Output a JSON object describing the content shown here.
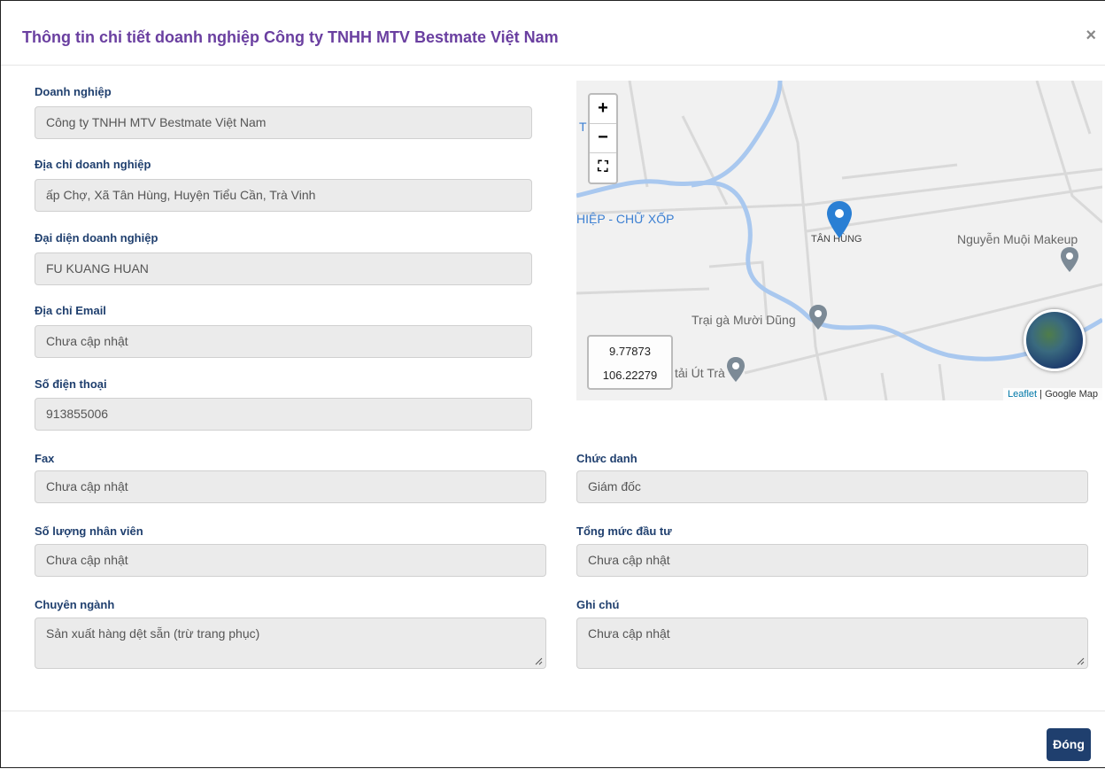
{
  "modal": {
    "title": "Thông tin chi tiết doanh nghiệp Công ty TNHH MTV Bestmate Việt Nam",
    "close_icon": "×",
    "close_button_label": "Đóng"
  },
  "fields": {
    "business": {
      "label": "Doanh nghiệp",
      "value": "Công ty TNHH MTV Bestmate Việt Nam"
    },
    "address": {
      "label": "Địa chỉ doanh nghiệp",
      "value": "ấp Chợ, Xã Tân Hùng, Huyện Tiểu Cần, Trà Vinh"
    },
    "representative": {
      "label": "Đại diện doanh nghiệp",
      "value": "FU KUANG HUAN"
    },
    "email": {
      "label": "Địa chỉ Email",
      "value": "Chưa cập nhật"
    },
    "phone": {
      "label": "Số điện thoại",
      "value": "913855006"
    },
    "fax": {
      "label": "Fax",
      "value": "Chưa cập nhật"
    },
    "position": {
      "label": "Chức danh",
      "value": "Giám đốc"
    },
    "employees": {
      "label": "Số lượng nhân viên",
      "value": "Chưa cập nhật"
    },
    "investment": {
      "label": "Tổng mức đầu tư",
      "value": "Chưa cập nhật"
    },
    "industry": {
      "label": "Chuyên ngành",
      "value": "Sản xuất hàng dệt sẵn (trừ trang phục)"
    },
    "note": {
      "label": "Ghi chú",
      "value": "Chưa cập nhật"
    }
  },
  "map": {
    "zoom_in": "+",
    "zoom_out": "−",
    "fullscreen_icon": "⛶",
    "labels": {
      "edge_t": "T",
      "place_hiep": "HIỆP - CHỮ XỐP",
      "place_tan_hung": "TÂN HÙNG",
      "poi_makeup": "Nguyễn Muội Makeup",
      "poi_farm": "Trại gà Mười Dũng",
      "poi_ut_tra": "tải Út Trà"
    },
    "coords": {
      "lat": "9.77873",
      "lng": "106.22279"
    },
    "attribution_link": "Leaflet",
    "attribution_text": "| Google Map",
    "colors": {
      "marker": "#2a7fd4",
      "poi": "#7c8a96",
      "river": "#a9c8ef"
    }
  }
}
